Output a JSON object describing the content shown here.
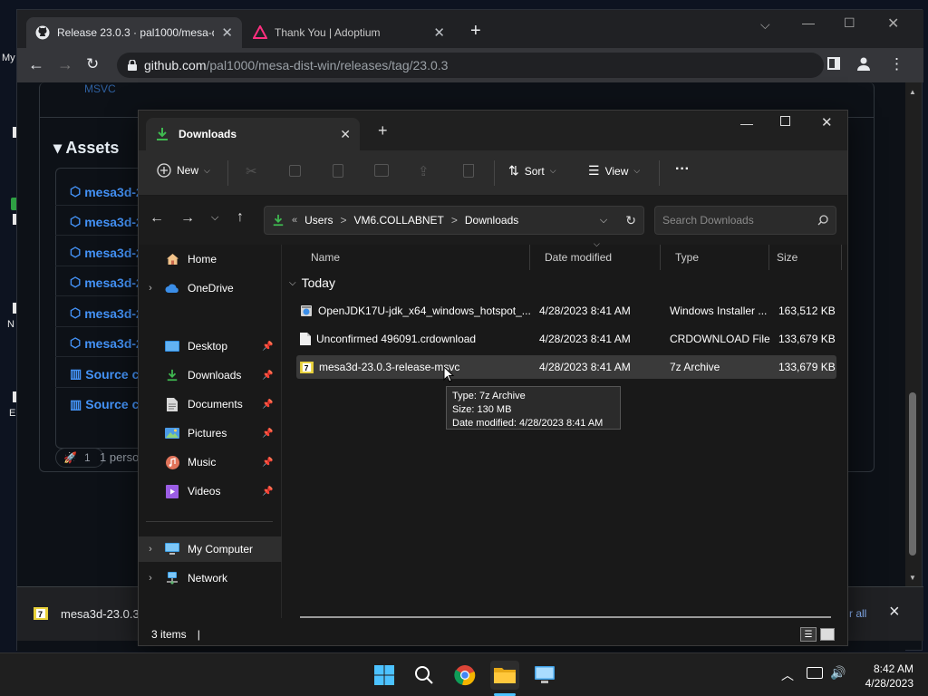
{
  "desktop": {
    "labels": [
      "My",
      "N",
      "E"
    ]
  },
  "browser": {
    "tabs": [
      {
        "title": "Release 23.0.3 · pal1000/mesa-dist-win",
        "active": true
      },
      {
        "title": "Thank You | Adoptium",
        "active": false
      }
    ],
    "new_tab": "+",
    "url_host": "github.com",
    "url_path": "/pal1000/mesa-dist-win/releases/tag/23.0.3",
    "page": {
      "assets_title": "Assets",
      "assets": [
        {
          "label": "mesa3d-2"
        },
        {
          "label": "mesa3d-2"
        },
        {
          "label": "mesa3d-2"
        },
        {
          "label": "mesa3d-2"
        },
        {
          "label": "mesa3d-2"
        },
        {
          "label": "mesa3d-2"
        },
        {
          "label": "Source co"
        },
        {
          "label": "Source co"
        }
      ],
      "reaction_count": "1",
      "reaction_text": "1 perso",
      "top_fragment": "MSVC"
    },
    "download_bar": {
      "file": "mesa3d-23.0.3",
      "show_all": "r all",
      "close": "×"
    }
  },
  "explorer": {
    "tab_title": "Downloads",
    "new_tab": "+",
    "cmd": {
      "new": "New",
      "sort": "Sort",
      "view": "View",
      "more": "···"
    },
    "address": {
      "prefix": "«",
      "crumbs": [
        "Users",
        "VM6.COLLABNET",
        "Downloads"
      ],
      "sep": ">"
    },
    "search_placeholder": "Search Downloads",
    "nav": {
      "home": "Home",
      "onedrive": "OneDrive",
      "desktop": "Desktop",
      "downloads": "Downloads",
      "documents": "Documents",
      "pictures": "Pictures",
      "music": "Music",
      "videos": "Videos",
      "my_computer": "My Computer",
      "network": "Network"
    },
    "columns": {
      "name": "Name",
      "date": "Date modified",
      "type": "Type",
      "size": "Size"
    },
    "group": "Today",
    "files": [
      {
        "name": "OpenJDK17U-jdk_x64_windows_hotspot_...",
        "date": "4/28/2023 8:41 AM",
        "type": "Windows Installer ...",
        "size": "163,512 KB",
        "icon": "installer-icon"
      },
      {
        "name": "Unconfirmed 496091.crdownload",
        "date": "4/28/2023 8:41 AM",
        "type": "CRDOWNLOAD File",
        "size": "133,679 KB",
        "icon": "file-icon"
      },
      {
        "name": "mesa3d-23.0.3-release-msvc",
        "date": "4/28/2023 8:41 AM",
        "type": "7z Archive",
        "size": "133,679 KB",
        "icon": "archive-7z-icon"
      }
    ],
    "tooltip": {
      "line1": "Type: 7z Archive",
      "line2": "Size: 130 MB",
      "line3": "Date modified: 4/28/2023 8:41 AM"
    },
    "status": "3 items",
    "status_cursor": "|"
  },
  "taskbar": {
    "time": "8:42 AM",
    "date": "4/28/2023"
  }
}
